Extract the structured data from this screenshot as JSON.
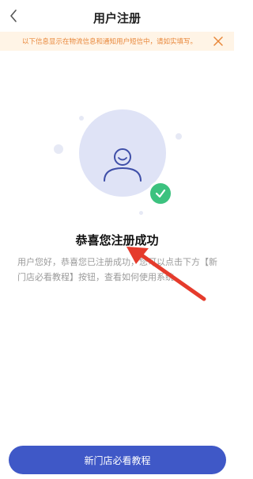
{
  "nav": {
    "title": "用户注册"
  },
  "notice": {
    "text": "以下信息显示在物流信息和通知用户短信中，请如实填写。"
  },
  "success": {
    "heading": "恭喜您注册成功",
    "description": "用户您好，恭喜您已注册成功，您可以点击下方【新门店必看教程】按钮，查看如何使用系统。"
  },
  "cta": {
    "label": "新门店必看教程"
  },
  "colors": {
    "accent": "#3f58c7",
    "success": "#3cc27f",
    "notice_bg": "#fff4e6",
    "notice_text": "#e8873a",
    "annotation_arrow": "#e53b2c"
  },
  "icons": [
    "back-icon",
    "close-icon",
    "user-icon",
    "check-icon"
  ]
}
